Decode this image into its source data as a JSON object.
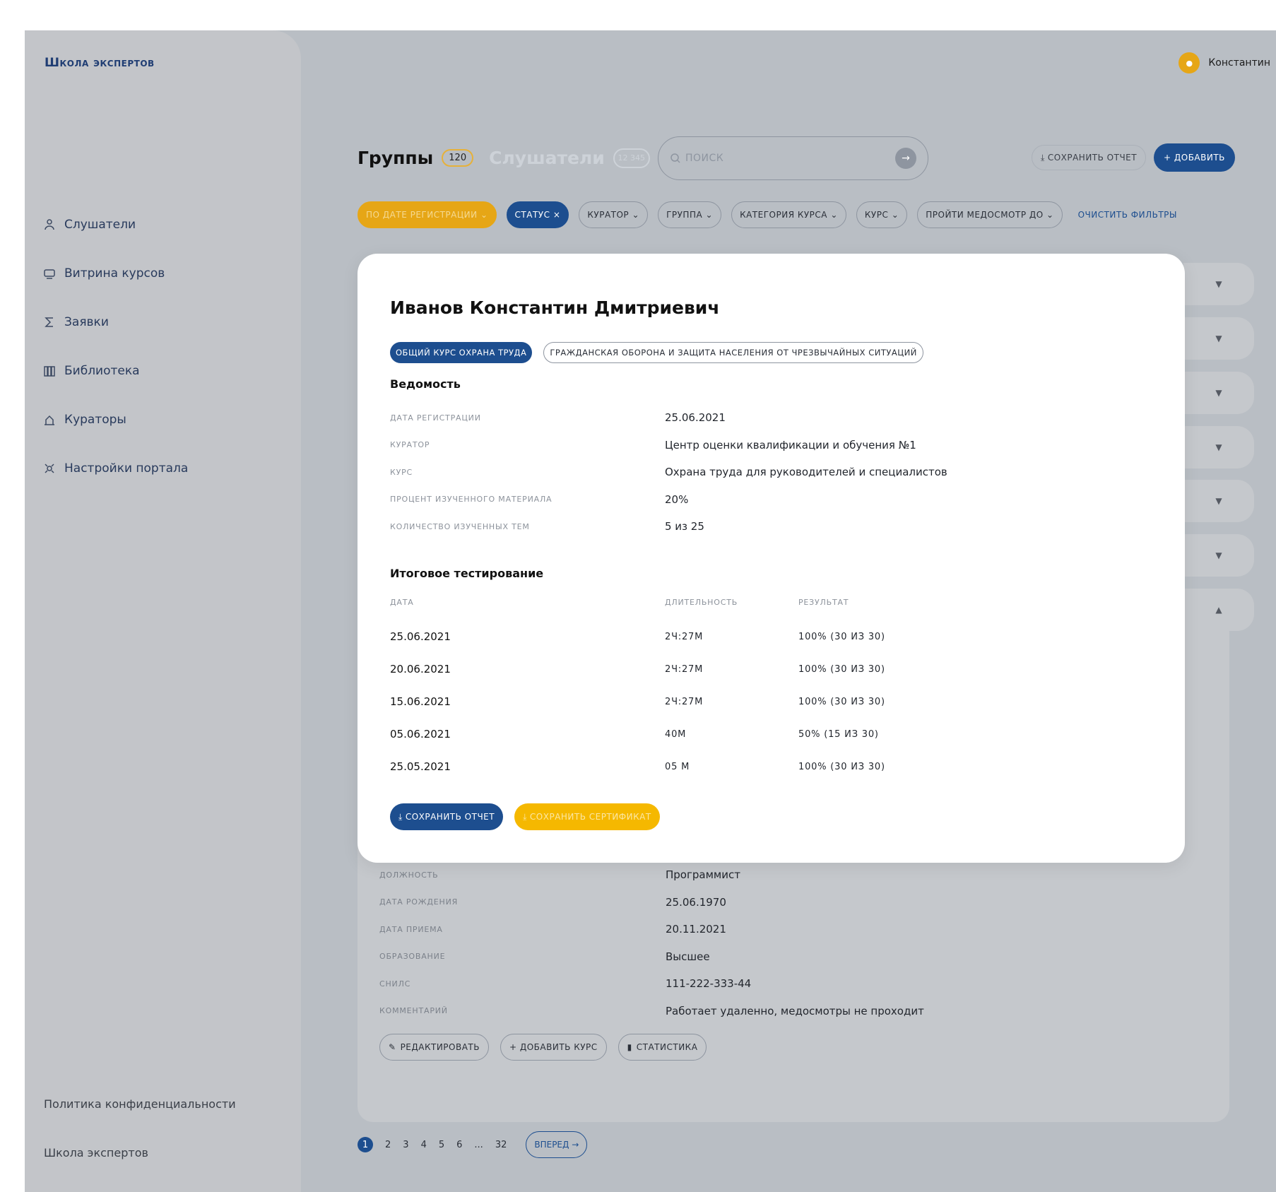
{
  "app": {
    "logo": "Школа экспертов",
    "user_name": "Константин"
  },
  "sidebar": {
    "items": [
      {
        "label": "Слушатели",
        "icon": "users-icon"
      },
      {
        "label": "Витрина курсов",
        "icon": "courses-icon"
      },
      {
        "label": "Заявки",
        "icon": "sigma-icon"
      },
      {
        "label": "Библиотека",
        "icon": "library-icon"
      },
      {
        "label": "Кураторы",
        "icon": "curators-icon"
      },
      {
        "label": "Настройки портала",
        "icon": "settings-icon"
      }
    ],
    "footer": [
      "Политика конфиденциальности",
      "Школа экспертов"
    ]
  },
  "header": {
    "title": "Группы",
    "count": "120",
    "tab_inactive": "Слушатели",
    "tab_inactive_count": "12 345",
    "search_placeholder": "ПОИСК",
    "save_report": "СОХРАНИТЬ ОТЧЕТ",
    "add": "+ ДОБАВИТЬ"
  },
  "filters": [
    {
      "label": "ПО ДАТЕ РЕГИСТРАЦИИ",
      "suffix": "⌄",
      "style": "yellow"
    },
    {
      "label": "СТАТУС",
      "suffix": "×",
      "style": "blue"
    },
    {
      "label": "КУРАТОР",
      "suffix": "⌄",
      "style": "outline"
    },
    {
      "label": "ГРУППА",
      "suffix": "⌄",
      "style": "outline"
    },
    {
      "label": "КАТЕГОРИЯ КУРСА",
      "suffix": "⌄",
      "style": "outline"
    },
    {
      "label": "КУРС",
      "suffix": "⌄",
      "style": "outline"
    },
    {
      "label": "ПРОЙТИ МЕДОСМОТР ДО",
      "suffix": "⌄",
      "style": "outline"
    }
  ],
  "clear_filters": "ОЧИСТИТЬ ФИЛЬТРЫ",
  "background_info": [
    {
      "label": "ДОЛЖНОСТЬ",
      "value": "Программист"
    },
    {
      "label": "ДАТА РОЖДЕНИЯ",
      "value": "25.06.1970"
    },
    {
      "label": "ДАТА ПРИЕМА",
      "value": "20.11.2021"
    },
    {
      "label": "ОБРАЗОВАНИЕ",
      "value": "Высшее"
    },
    {
      "label": "СНИЛС",
      "value": "111-222-333-44"
    },
    {
      "label": "КОММЕНТАРИЙ",
      "value": "Работает удаленно, медосмотры не проходит"
    }
  ],
  "background_actions": [
    "РЕДАКТИРОВАТЬ",
    "+ ДОБАВИТЬ КУРС",
    "СТАТИСТИКА"
  ],
  "pagination": {
    "pages": [
      "1",
      "2",
      "3",
      "4",
      "5",
      "6",
      "...",
      "32"
    ],
    "next": "ВПЕРЕД →"
  },
  "modal": {
    "title": "Иванов Константин Дмитриевич",
    "tags": [
      "ОБЩИЙ КУРС ОХРАНА ТРУДА",
      "ГРАЖДАНСКАЯ ОБОРОНА И ЗАЩИТА НАСЕЛЕНИЯ ОТ ЧРЕЗВЫЧАЙНЫХ СИТУАЦИЙ"
    ],
    "section1": "Ведомость",
    "info": [
      {
        "label": "ДАТА РЕГИСТРАЦИИ",
        "value": "25.06.2021"
      },
      {
        "label": "КУРАТОР",
        "value": "Центр оценки квалификации и обучения №1"
      },
      {
        "label": "КУРС",
        "value": "Охрана труда для руководителей и специалистов"
      },
      {
        "label": "ПРОЦЕНТ ИЗУЧЕННОГО МАТЕРИАЛА",
        "value": "20%"
      },
      {
        "label": "КОЛИЧЕСТВО ИЗУЧЕННЫХ ТЕМ",
        "value": "5 из 25"
      }
    ],
    "section2": "Итоговое тестирование",
    "table_headers": [
      "ДАТА",
      "ДЛИТЕЛЬНОСТЬ",
      "РЕЗУЛЬТАТ"
    ],
    "table_rows": [
      [
        "25.06.2021",
        "2Ч:27М",
        "100% (30 ИЗ 30)"
      ],
      [
        "20.06.2021",
        "2Ч:27М",
        "100% (30 ИЗ 30)"
      ],
      [
        "15.06.2021",
        "2Ч:27М",
        "100% (30 ИЗ 30)"
      ],
      [
        "05.06.2021",
        "40М",
        "50% (15 ИЗ 30)"
      ],
      [
        "25.05.2021",
        "05 М",
        "100% (30 ИЗ 30)"
      ]
    ],
    "save_report": "СОХРАНИТЬ ОТЧЕТ",
    "save_certificate": "СОХРАНИТЬ СЕРТИФИКАТ"
  }
}
